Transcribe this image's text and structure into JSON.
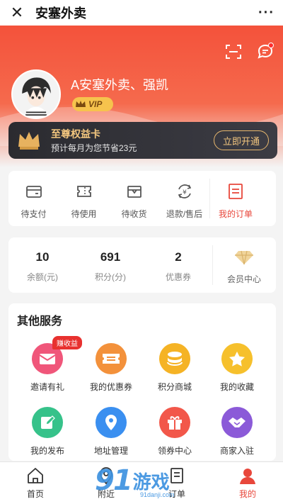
{
  "topbar": {
    "close_icon": "close-icon",
    "title": "安塞外卖",
    "more_icon": "more-icon"
  },
  "header": {
    "username": "A安塞外卖、强凯",
    "vip_label": "VIP",
    "icons": [
      "scan-icon",
      "message-icon"
    ]
  },
  "privilege": {
    "title": "至尊权益卡",
    "subtitle": "预计每月为您节省23元",
    "button": "立即开通"
  },
  "orders": {
    "items": [
      {
        "label": "待支付",
        "icon": "wallet-icon"
      },
      {
        "label": "待使用",
        "icon": "ticket-icon"
      },
      {
        "label": "待收货",
        "icon": "box-icon"
      },
      {
        "label": "退款/售后",
        "icon": "refund-icon"
      }
    ],
    "my_orders": {
      "label": "我的订单",
      "icon": "order-list-icon"
    }
  },
  "stats": {
    "items": [
      {
        "value": "10",
        "label": "余额(元)"
      },
      {
        "value": "691",
        "label": "积分(分)"
      },
      {
        "value": "2",
        "label": "优惠券"
      }
    ],
    "member": {
      "label": "会员中心",
      "icon": "diamond-icon"
    }
  },
  "services": {
    "title": "其他服务",
    "badge": "赚收益",
    "items": [
      {
        "label": "邀请有礼",
        "icon": "envelope-icon",
        "color": "#f0567a"
      },
      {
        "label": "我的优惠券",
        "icon": "coupon-icon",
        "color": "#f3913b"
      },
      {
        "label": "积分商城",
        "icon": "coins-icon",
        "color": "#f5b325"
      },
      {
        "label": "我的收藏",
        "icon": "star-icon",
        "color": "#f6c02c"
      },
      {
        "label": "我的发布",
        "icon": "edit-icon",
        "color": "#36c28a"
      },
      {
        "label": "地址管理",
        "icon": "location-icon",
        "color": "#3a8ff0"
      },
      {
        "label": "领券中心",
        "icon": "gift-icon",
        "color": "#f2574a"
      },
      {
        "label": "商家入驻",
        "icon": "handshake-icon",
        "color": "#8b5ad8"
      }
    ]
  },
  "tabbar": {
    "items": [
      {
        "label": "首页",
        "icon": "home-icon"
      },
      {
        "label": "附近",
        "icon": "location-pin-icon"
      },
      {
        "label": "订单",
        "icon": "order-icon"
      },
      {
        "label": "我的",
        "icon": "user-icon",
        "active": true
      }
    ]
  },
  "watermark": {
    "number": "91",
    "text": "游戏",
    "url": "91danji.com"
  },
  "colors": {
    "primary": "#f4523b",
    "accent_red": "#e8473b",
    "gold": "#f4c77f",
    "dark_card": "#2b2b30"
  }
}
